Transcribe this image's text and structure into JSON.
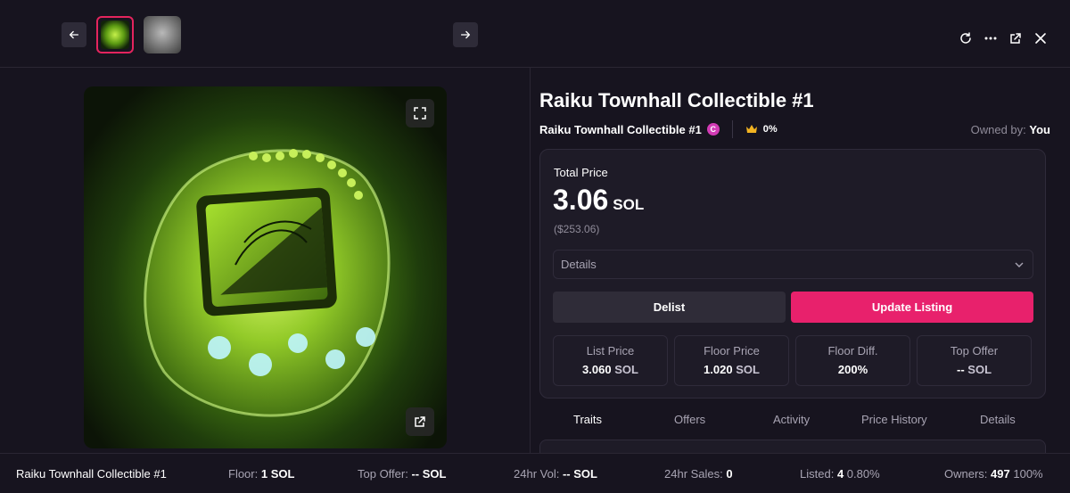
{
  "topbar": {
    "thumbnails": [
      "Raiku dragon collectible",
      "stone statue"
    ],
    "icons": [
      "arrow-left-icon",
      "arrow-right-icon",
      "refresh-icon",
      "more-icon",
      "external-link-icon",
      "close-icon"
    ]
  },
  "item": {
    "title": "Raiku Townhall Collectible #1",
    "collection_name": "Raiku Townhall Collectible #1",
    "collection_badge": "C",
    "rank_percent": "0%",
    "owned_by_label": "Owned by:",
    "owned_by_value": "You"
  },
  "price": {
    "total_label": "Total Price",
    "amount": "3.06",
    "currency": "SOL",
    "usd": "($253.06)",
    "details_label": "Details",
    "delist_label": "Delist",
    "update_label": "Update Listing"
  },
  "stats": [
    {
      "label": "List Price",
      "value": "3.060",
      "unit": "SOL"
    },
    {
      "label": "Floor Price",
      "value": "1.020",
      "unit": "SOL"
    },
    {
      "label": "Floor Diff.",
      "value": "200%",
      "unit": ""
    },
    {
      "label": "Top Offer",
      "value": "--",
      "unit": "SOL"
    }
  ],
  "tabs": [
    "Traits",
    "Offers",
    "Activity",
    "Price History",
    "Details"
  ],
  "statusbar": {
    "name": "Raiku Townhall Collectible #1",
    "floor_label": "Floor:",
    "floor_value": "1",
    "floor_unit": "SOL",
    "top_offer_label": "Top Offer:",
    "top_offer_value": "--",
    "top_offer_unit": "SOL",
    "vol_label": "24hr Vol:",
    "vol_value": "--",
    "vol_unit": "SOL",
    "sales_label": "24hr Sales:",
    "sales_value": "0",
    "listed_label": "Listed:",
    "listed_value": "4",
    "listed_pct": "0.80%",
    "owners_label": "Owners:",
    "owners_value": "497",
    "owners_pct": "100%"
  },
  "colors": {
    "background": "#17141f",
    "card": "#1e1b27",
    "accent": "#e8216c",
    "muted_text": "#a8a4b3"
  }
}
